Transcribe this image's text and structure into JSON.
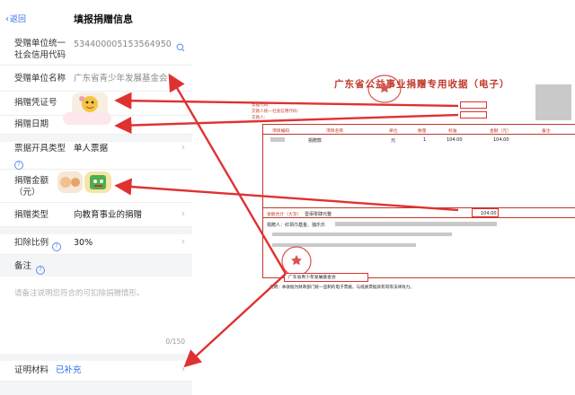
{
  "nav": {
    "back_label": "返回",
    "title": "填报捐赠信息"
  },
  "form": {
    "credit_code_label": "受赠单位统一社会信用代码",
    "credit_code_value": "534400005153564950",
    "unit_name_label": "受赠单位名称",
    "unit_name_value": "广东省青少年发展基金会",
    "voucher_label": "捐赠凭证号",
    "date_label": "捐赠日期",
    "ticket_type_label": "票据开具类型",
    "ticket_type_value": "单人票据",
    "amount_label": "捐赠金额（元）",
    "donation_type_label": "捐赠类型",
    "donation_type_value": "向教育事业的捐赠",
    "ratio_label": "扣除比例",
    "ratio_value": "30%",
    "remark_label": "备注",
    "remark_placeholder": "请备注说明您符合的可扣除捐赠情形。",
    "remark_counter": "0/150",
    "proof_label": "证明材料",
    "proof_value": "已补充"
  },
  "receipt": {
    "title": "广东省公益事业捐赠专用收据（电子）",
    "meta_lines": [
      "票据代码:",
      "交款人统一社会信用代码:",
      "交款人:"
    ],
    "headers": [
      "项目编码",
      "项目名称",
      "单位",
      "数量",
      "标准",
      "金额（元）",
      "备注"
    ],
    "item_name": "捐赠款",
    "item_unit": "元",
    "item_qty": "1",
    "item_std": "104.00",
    "item_amount": "104.00",
    "total_label": "金额合计（大写）",
    "total_words": "壹佰零肆元整",
    "total_amount": "104.00",
    "donor_line": "捐赠人：红领巾基金、独乐乐",
    "unit_stamp": "广东省青少年发展基金会",
    "stamp_text": "财务专用章",
    "footer_note": "说明：本收据为财政部门统一监制的电子票据，与纸质票据具有同等法律效力。"
  },
  "colors": {
    "accent": "#2f6fec",
    "receipt_red": "#c0392b",
    "highlight": "#e03131"
  }
}
